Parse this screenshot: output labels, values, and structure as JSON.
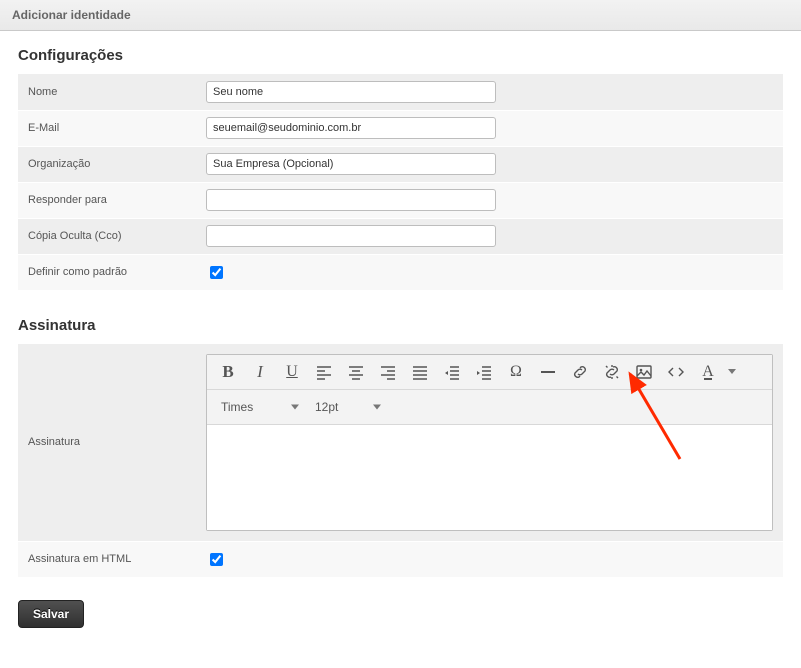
{
  "titlebar": "Adicionar identidade",
  "sections": {
    "config_title": "Configurações",
    "signature_title": "Assinatura"
  },
  "fields": {
    "name_label": "Nome",
    "name_value": "Seu nome",
    "email_label": "E-Mail",
    "email_value": "seuemail@seudominio.com.br",
    "org_label": "Organização",
    "org_value": "Sua Empresa (Opcional)",
    "replyto_label": "Responder para",
    "replyto_value": "",
    "bcc_label": "Cópia Oculta (Cco)",
    "bcc_value": "",
    "default_label": "Definir como padrão",
    "default_checked": true,
    "signature_label": "Assinatura",
    "signature_html_label": "Assinatura em HTML",
    "signature_html_checked": true
  },
  "editor": {
    "font_family": "Times",
    "font_size": "12pt"
  },
  "buttons": {
    "save": "Salvar"
  }
}
